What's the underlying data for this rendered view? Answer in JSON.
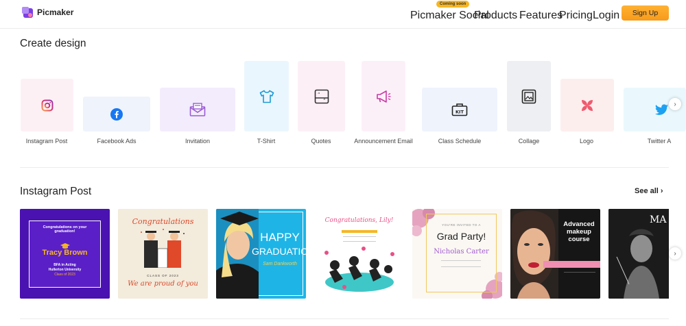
{
  "header": {
    "logo_text": "Picmaker",
    "coming_soon": "Coming soon",
    "nav": {
      "social": "Picmaker Social",
      "products": "Products",
      "features": "Features",
      "pricing": "Pricing",
      "login": "Login"
    },
    "signup": "Sign Up"
  },
  "create_design": {
    "title": "Create design",
    "items": [
      {
        "label": "Instagram Post",
        "icon": "instagram-icon"
      },
      {
        "label": "Facebook Ads",
        "icon": "facebook-icon"
      },
      {
        "label": "Invitation",
        "icon": "envelope-icon"
      },
      {
        "label": "T-Shirt",
        "icon": "tshirt-icon"
      },
      {
        "label": "Quotes",
        "icon": "quote-icon"
      },
      {
        "label": "Announcement Email",
        "icon": "megaphone-icon"
      },
      {
        "label": "Class Schedule",
        "icon": "kit-icon"
      },
      {
        "label": "Collage",
        "icon": "collage-icon"
      },
      {
        "label": "Logo",
        "icon": "logo-icon"
      },
      {
        "label": "Twitter A",
        "icon": "twitter-icon"
      }
    ]
  },
  "instagram_post": {
    "title": "Instagram Post",
    "see_all": "See all",
    "cards": [
      {
        "heading": "Congratulations on your graduation!",
        "name": "Tracy Brown",
        "line1": "BFA in Acting",
        "line2": "Hullerton University",
        "line3": "Class of 2023"
      },
      {
        "heading": "Congratulations",
        "line1": "CLASS OF 2023",
        "line2": "We are proud of you"
      },
      {
        "heading1": "HAPPY",
        "heading2": "GRADUATION",
        "name": "Sam Dankworth"
      },
      {
        "heading": "Congratulations, Lily!"
      },
      {
        "small": "YOU'RE INVITED TO A",
        "heading": "Grad Party!",
        "name": "Nicholas Carter"
      },
      {
        "heading1": "Advanced",
        "heading2": "makeup",
        "heading3": "course"
      },
      {
        "heading": "MA"
      }
    ]
  },
  "colors": {
    "accent": "#f79a1a",
    "purple": "#5b1fc2",
    "text": "#222222"
  }
}
